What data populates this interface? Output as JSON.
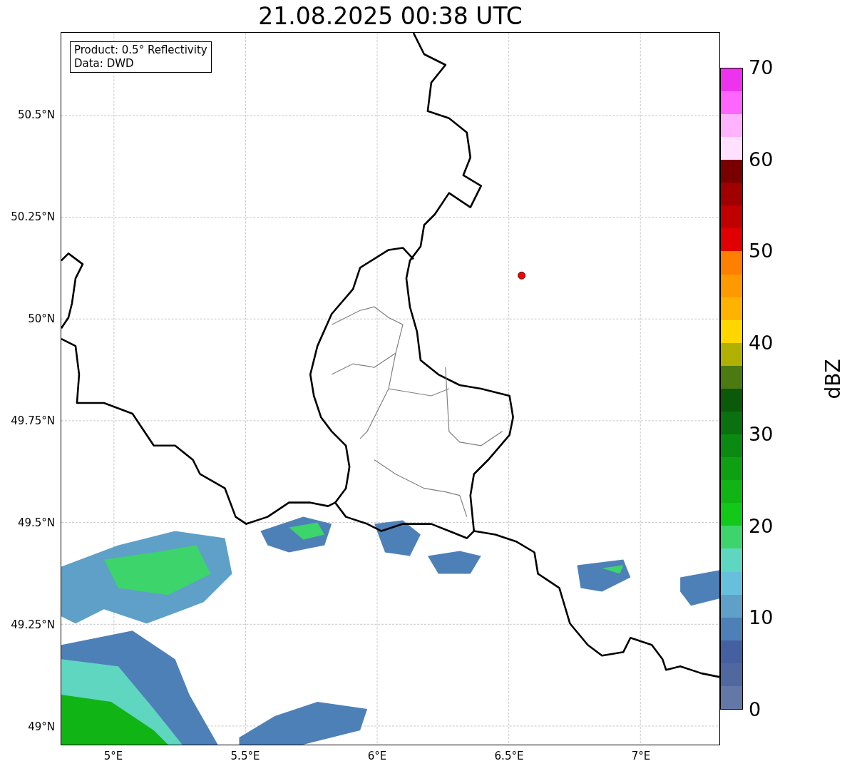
{
  "title": "21.08.2025 00:38 UTC",
  "legend": {
    "lines": [
      "Product: 0.5° Reflectivity",
      "Data: DWD"
    ]
  },
  "y_ticks": [
    {
      "label": "50.5°N"
    },
    {
      "label": "50.25°N"
    },
    {
      "label": "50°N"
    },
    {
      "label": "49.75°N"
    },
    {
      "label": "49.5°N"
    },
    {
      "label": "49.25°N"
    },
    {
      "label": "49°N"
    }
  ],
  "x_ticks": [
    {
      "label": "5°E"
    },
    {
      "label": "5.5°E"
    },
    {
      "label": "6°E"
    },
    {
      "label": "6.5°E"
    },
    {
      "label": "7°E"
    }
  ],
  "colorbar": {
    "label": "dBZ",
    "ticks": [
      "70",
      "60",
      "50",
      "40",
      "30",
      "20",
      "10",
      "0"
    ],
    "bins": [
      {
        "color": "#6478a8"
      },
      {
        "color": "#5068a0"
      },
      {
        "color": "#4560a0"
      },
      {
        "color": "#4e80b8"
      },
      {
        "color": "#5ea0c8"
      },
      {
        "color": "#66c0db"
      },
      {
        "color": "#5fd6c0"
      },
      {
        "color": "#3dd46b"
      },
      {
        "color": "#12c818"
      },
      {
        "color": "#10b515"
      },
      {
        "color": "#0ea012"
      },
      {
        "color": "#0a8a10"
      },
      {
        "color": "#0a7010"
      },
      {
        "color": "#0a5a0a"
      },
      {
        "color": "#4a7a10"
      },
      {
        "color": "#b0b000"
      },
      {
        "color": "#ffd700"
      },
      {
        "color": "#ffb300"
      },
      {
        "color": "#ff9900"
      },
      {
        "color": "#ff7f00"
      },
      {
        "color": "#e00000"
      },
      {
        "color": "#c00000"
      },
      {
        "color": "#a00000"
      },
      {
        "color": "#7a0000"
      },
      {
        "color": "#ffe0ff"
      },
      {
        "color": "#ffb3ff"
      },
      {
        "color": "#ff66ff"
      },
      {
        "color": "#ee33ee"
      }
    ]
  }
}
